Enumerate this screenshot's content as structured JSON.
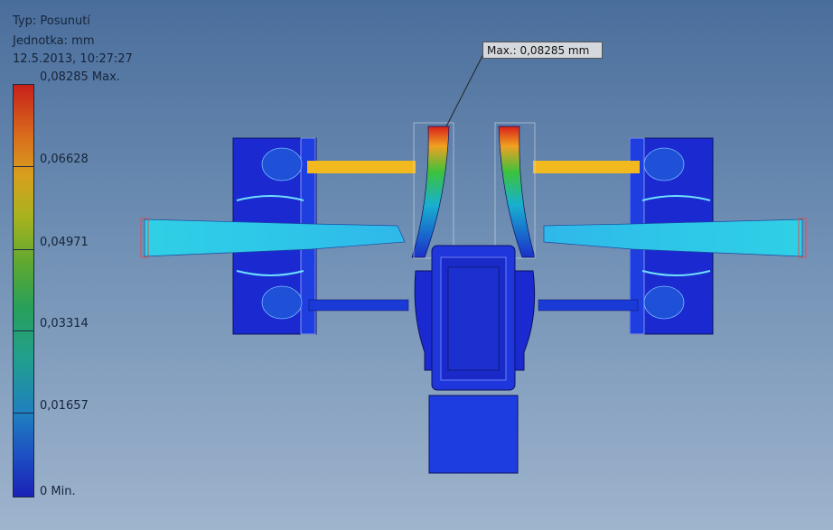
{
  "header": {
    "type_line": "Typ: Posunutí",
    "unit_line": "Jednotka: mm",
    "date_line": "12.5.2013, 10:27:27"
  },
  "legend": {
    "max_label": "0,08285 Max.",
    "labels": [
      "0,06628",
      "0,04971",
      "0,03314",
      "0,01657"
    ],
    "min_label": "0 Min."
  },
  "callout": {
    "text": "Max.: 0,08285 mm"
  },
  "colors": {
    "background_top": "#4a6e9c",
    "background_bottom": "#9fb4cd",
    "low": "#1a22b8",
    "mid": "#28a05a",
    "high": "#c8201a"
  },
  "icons": {
    "model": "fea-displacement-model"
  }
}
